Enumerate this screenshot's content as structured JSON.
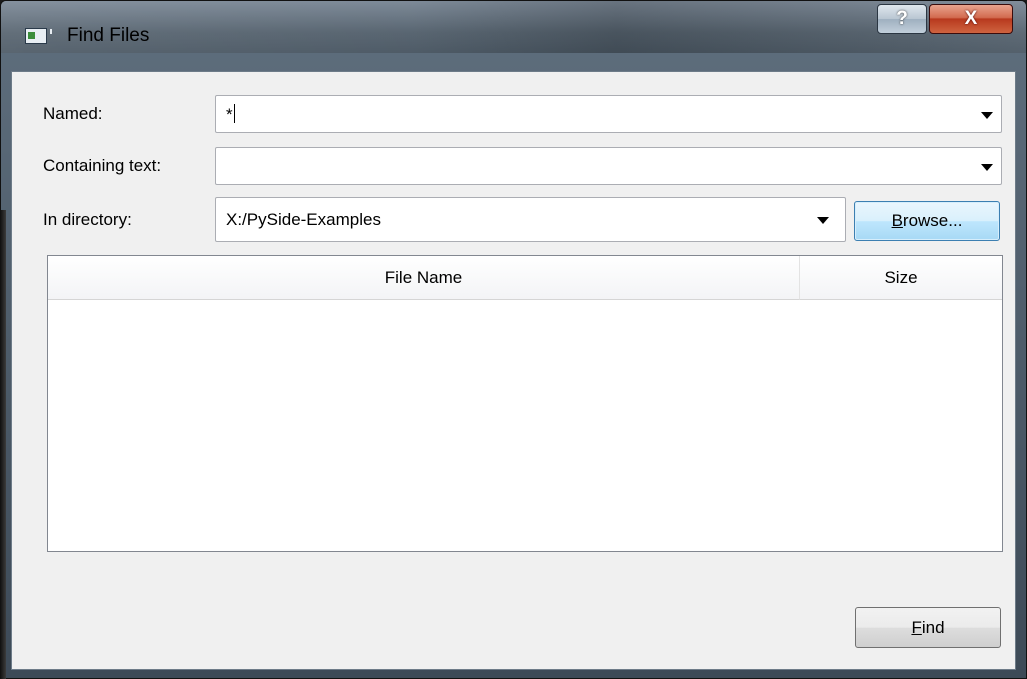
{
  "window": {
    "title": "Find Files",
    "help_label": "?",
    "close_label": "X"
  },
  "form": {
    "named_label": "Named:",
    "named_value": "*",
    "containing_label": "Containing text:",
    "containing_value": "",
    "directory_label": "In directory:",
    "directory_value": "X:/PySide-Examples",
    "browse_label": "Browse...",
    "browse_mnemonic": "B"
  },
  "table": {
    "columns": [
      "File Name",
      "Size"
    ],
    "rows": []
  },
  "actions": {
    "find_label": "Find",
    "find_mnemonic": "F"
  },
  "colors": {
    "dialog_bg": "#f0f0f0",
    "focus_button": "#bee6fd",
    "close_button": "#c7452a"
  },
  "icons": [
    "window-app-icon",
    "dropdown-arrow-icon"
  ]
}
